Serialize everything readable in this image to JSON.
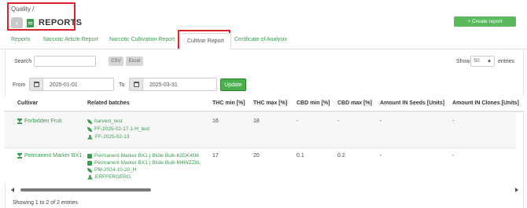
{
  "header": {
    "breadcrumb": "Quality /",
    "back_glyph": "‹",
    "title": "REPORTS",
    "create_button": "+ Create report"
  },
  "tabs": [
    {
      "label": "Reports",
      "active": false
    },
    {
      "label": "Narcotic Article Report",
      "active": false
    },
    {
      "label": "Narcotic Cultivation Report",
      "active": false
    },
    {
      "label": "Cultivar Report",
      "active": true
    },
    {
      "label": "Certificate of Analysis",
      "active": false
    }
  ],
  "toolbar": {
    "search_label": "Search",
    "search_value": "",
    "csv_label": "CSV",
    "excel_label": "Excel",
    "show_label": "Show",
    "page_size": "50",
    "entries_label": "entries"
  },
  "date_filter": {
    "from_label": "From",
    "from_value": "2025-01-01",
    "to_label": "To",
    "to_value": "2025-03-31",
    "update_label": "Update"
  },
  "table": {
    "headers": [
      "Cultivar",
      "Related batches",
      "THC min [%]",
      "THC max [%]",
      "CBD min [%]",
      "CBD max [%]",
      "Amount IN Seeds [Units]",
      "Amount IN Clones [Units]"
    ],
    "rows": [
      {
        "cultivar": "Forbidden Fruit",
        "batches": [
          {
            "icon": "leaf-icon",
            "label": "harvest_test"
          },
          {
            "icon": "leaf-icon",
            "label": "FF-2025-02-17-1-H_test"
          },
          {
            "icon": "plants-icon",
            "label": "FF-2025-02-13"
          }
        ],
        "thc_min": "16",
        "thc_max": "18",
        "cbd_min": "-",
        "cbd_max": "-",
        "seeds": "-",
        "clones": "-"
      },
      {
        "cultivar": "Permanent Marker BX1",
        "batches": [
          {
            "icon": "box-icon",
            "label": "Permanent Marker BX1 | Blüte Bulk-62DK4N6"
          },
          {
            "icon": "box-icon",
            "label": "Permanent Marker BX1 | Blüte Bulk-M4WZZ8L"
          },
          {
            "icon": "leaf-icon",
            "label": "PM-2024-10-20_H"
          },
          {
            "icon": "plants-icon",
            "label": "ERFFERGERG"
          }
        ],
        "thc_min": "17",
        "thc_max": "20",
        "cbd_min": "0.1",
        "cbd_max": "0.2",
        "seeds": "-",
        "clones": "-"
      }
    ]
  },
  "footer": {
    "info": "Showing 1 to 2 of 2 entries"
  },
  "colors": {
    "accent_green": "#3c9a52",
    "button_green": "#5cb85c",
    "highlight_red": "#d9232d",
    "row_shade": "#f7f7f7"
  }
}
